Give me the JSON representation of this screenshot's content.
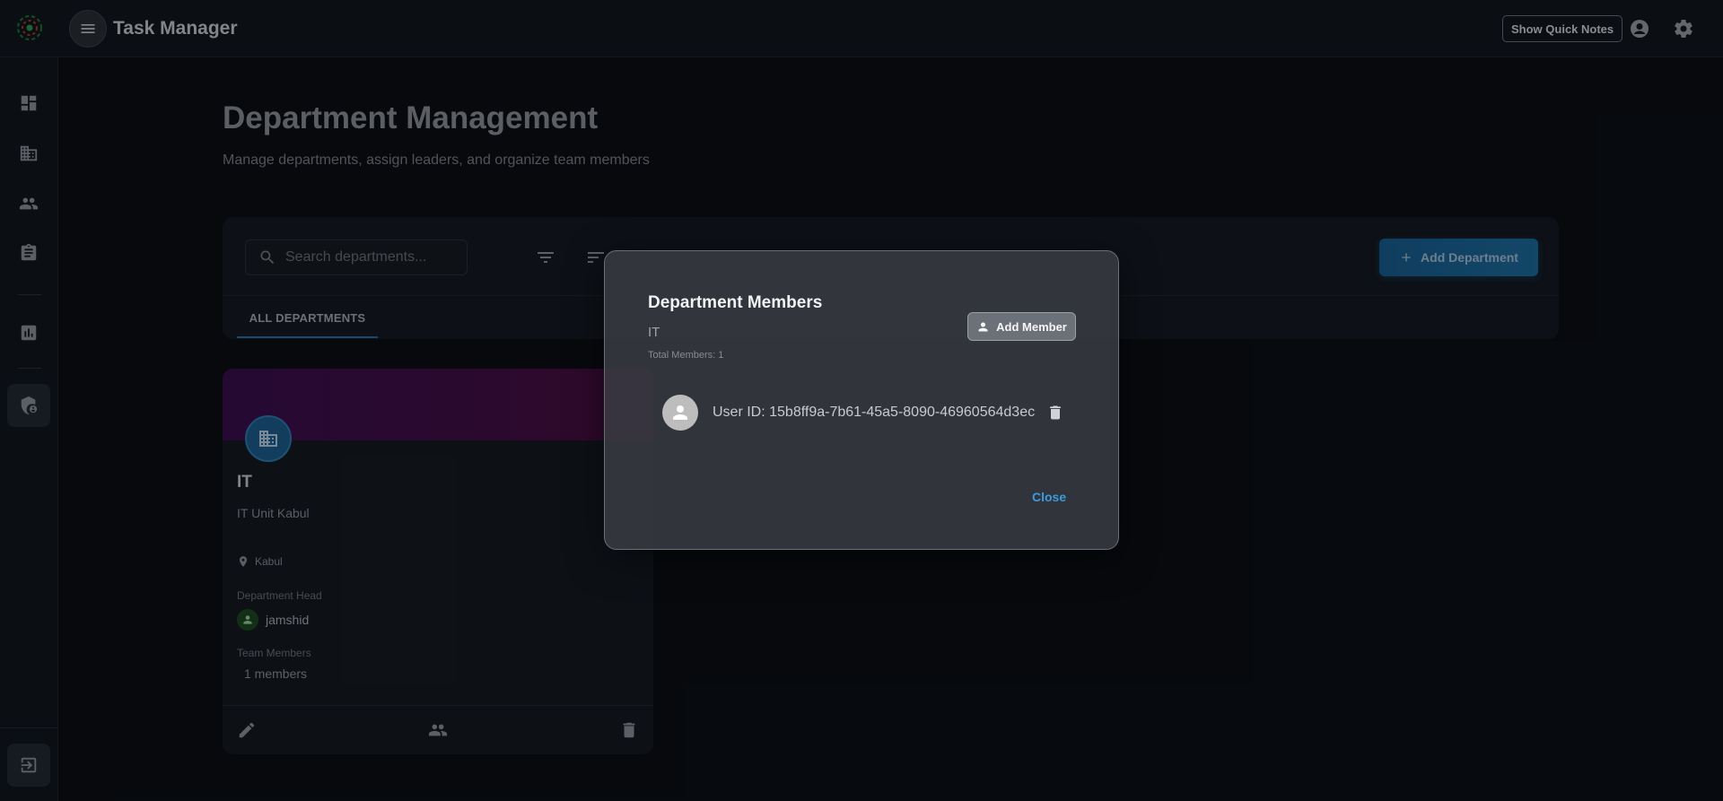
{
  "app": {
    "title": "Task Manager",
    "quick_notes_label": "Show Quick Notes"
  },
  "icons": {
    "logo": "spiral-logo-icon",
    "menu": "menu-icon",
    "account": "account-circle-icon",
    "settings": "gear-icon",
    "sidebar": [
      "dashboard-icon",
      "building-icon",
      "people-icon",
      "clipboard-icon",
      "bar-chart-icon",
      "shield-person-icon",
      "logout-icon"
    ],
    "search": "search-icon",
    "filter": "filter-icon",
    "sort": "sort-icon",
    "add": "plus-icon",
    "location": "location-pin-icon",
    "person": "person-icon",
    "edit": "pencil-icon",
    "group": "group-icon",
    "delete": "trash-icon"
  },
  "page": {
    "title": "Department Management",
    "subtitle": "Manage departments, assign leaders, and organize team members"
  },
  "toolbar": {
    "search_placeholder": "Search departments...",
    "add_department_label": "Add Department",
    "tabs": [
      {
        "label": "ALL DEPARTMENTS",
        "active": true
      }
    ]
  },
  "department_card": {
    "name": "IT",
    "description": "IT Unit Kabul",
    "location": "Kabul",
    "head_label": "Department Head",
    "head_name": "jamshid",
    "members_label": "Team Members",
    "members_count": "1 members"
  },
  "modal": {
    "title": "Department Members",
    "department": "IT",
    "total_members": "Total Members: 1",
    "add_member_label": "Add Member",
    "members": [
      {
        "label": "User ID: 15b8ff9a-7b61-45a5-8090-46960564d3ec"
      }
    ],
    "close_label": "Close"
  },
  "colors": {
    "background": "#0b0f15",
    "accent_blue": "#1c6da0",
    "link_blue": "#3a9be0",
    "banner_purple": "#420f48"
  }
}
